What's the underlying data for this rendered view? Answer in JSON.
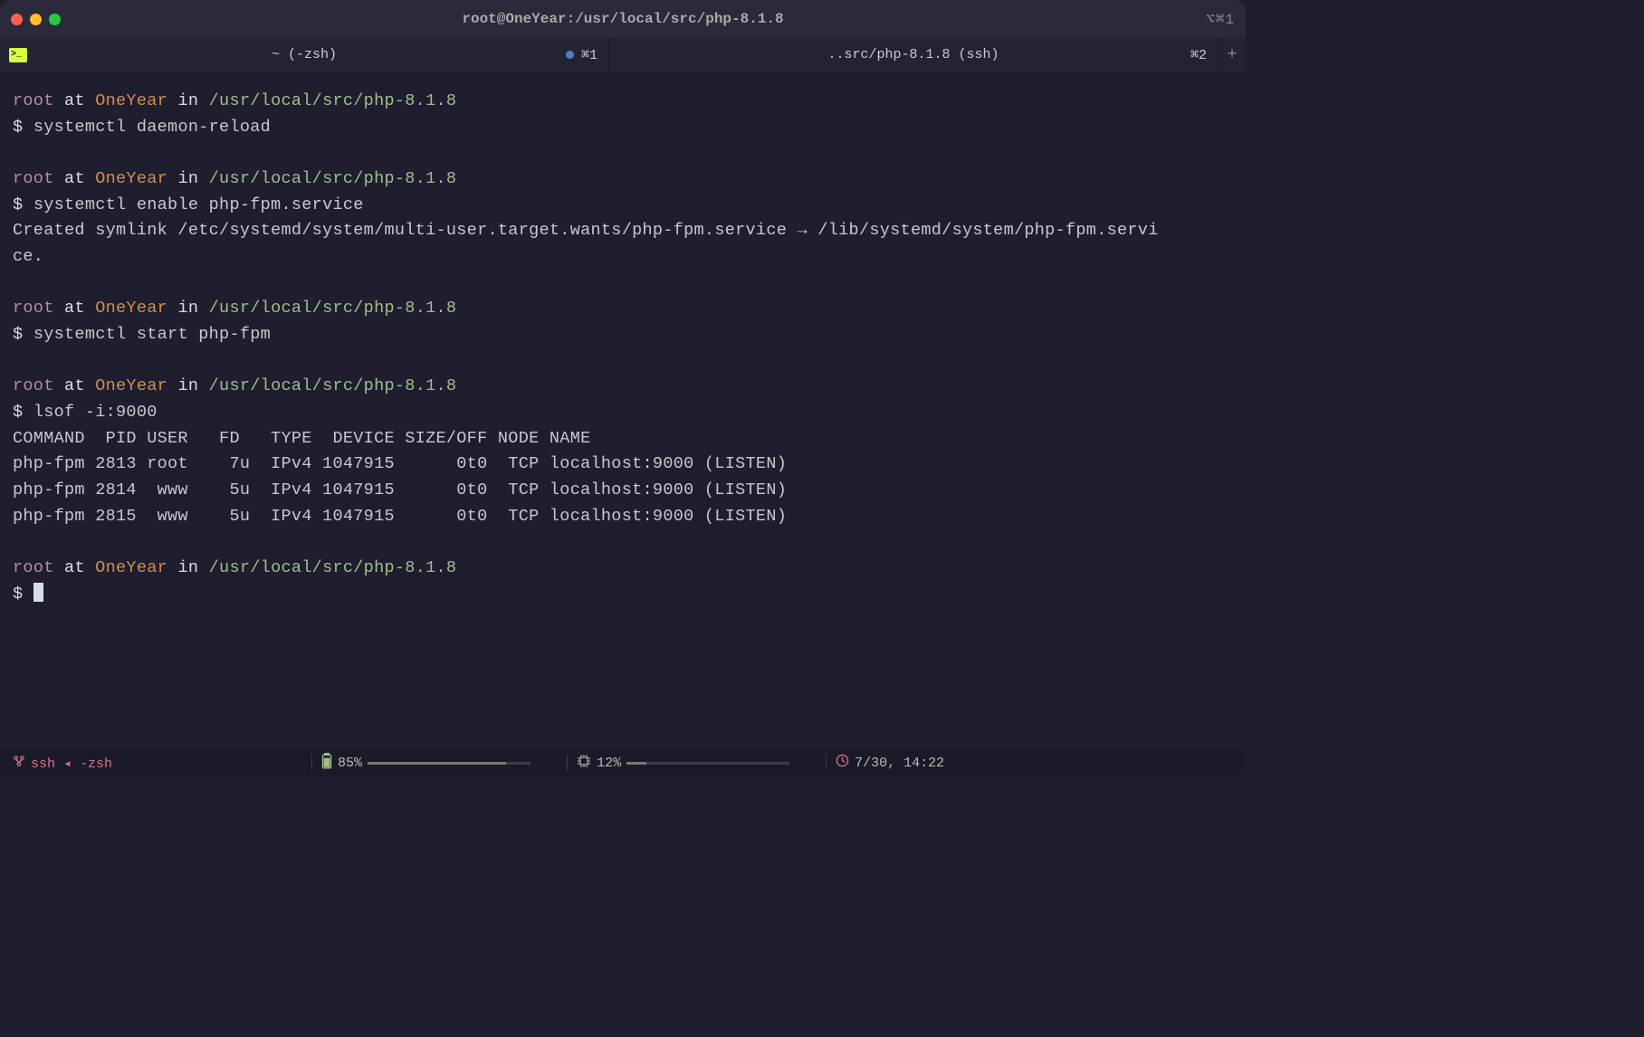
{
  "window": {
    "title": "root@OneYear:/usr/local/src/php-8.1.8",
    "shortcut_hint": "⌥⌘1"
  },
  "tabs": [
    {
      "label": "~ (-zsh)",
      "shortcut": "⌘1",
      "has_dot": true
    },
    {
      "label": "..src/php-8.1.8 (ssh)",
      "shortcut": "⌘2",
      "has_dot": false
    }
  ],
  "prompt": {
    "user": "root",
    "at": " at ",
    "host": "OneYear",
    "in": " in ",
    "path": "/usr/local/src/php-8.1.8",
    "symbol": "$ "
  },
  "blocks": [
    {
      "cmd": "systemctl daemon-reload",
      "out": ""
    },
    {
      "cmd": "systemctl enable php-fpm.service",
      "out": "Created symlink /etc/systemd/system/multi-user.target.wants/php-fpm.service → /lib/systemd/system/php-fpm.servi\nce."
    },
    {
      "cmd": "systemctl start php-fpm",
      "out": ""
    },
    {
      "cmd": "lsof -i:9000",
      "out": "COMMAND  PID USER   FD   TYPE  DEVICE SIZE/OFF NODE NAME\nphp-fpm 2813 root    7u  IPv4 1047915      0t0  TCP localhost:9000 (LISTEN)\nphp-fpm 2814  www    5u  IPv4 1047915      0t0  TCP localhost:9000 (LISTEN)\nphp-fpm 2815  www    5u  IPv4 1047915      0t0  TCP localhost:9000 (LISTEN)"
    }
  ],
  "status": {
    "left": "ssh ◂ -zsh",
    "battery": "85%",
    "cpu": "12%",
    "clock": "7/30, 14:22",
    "battery_fill": "85%",
    "cpu_fill": "12%"
  }
}
